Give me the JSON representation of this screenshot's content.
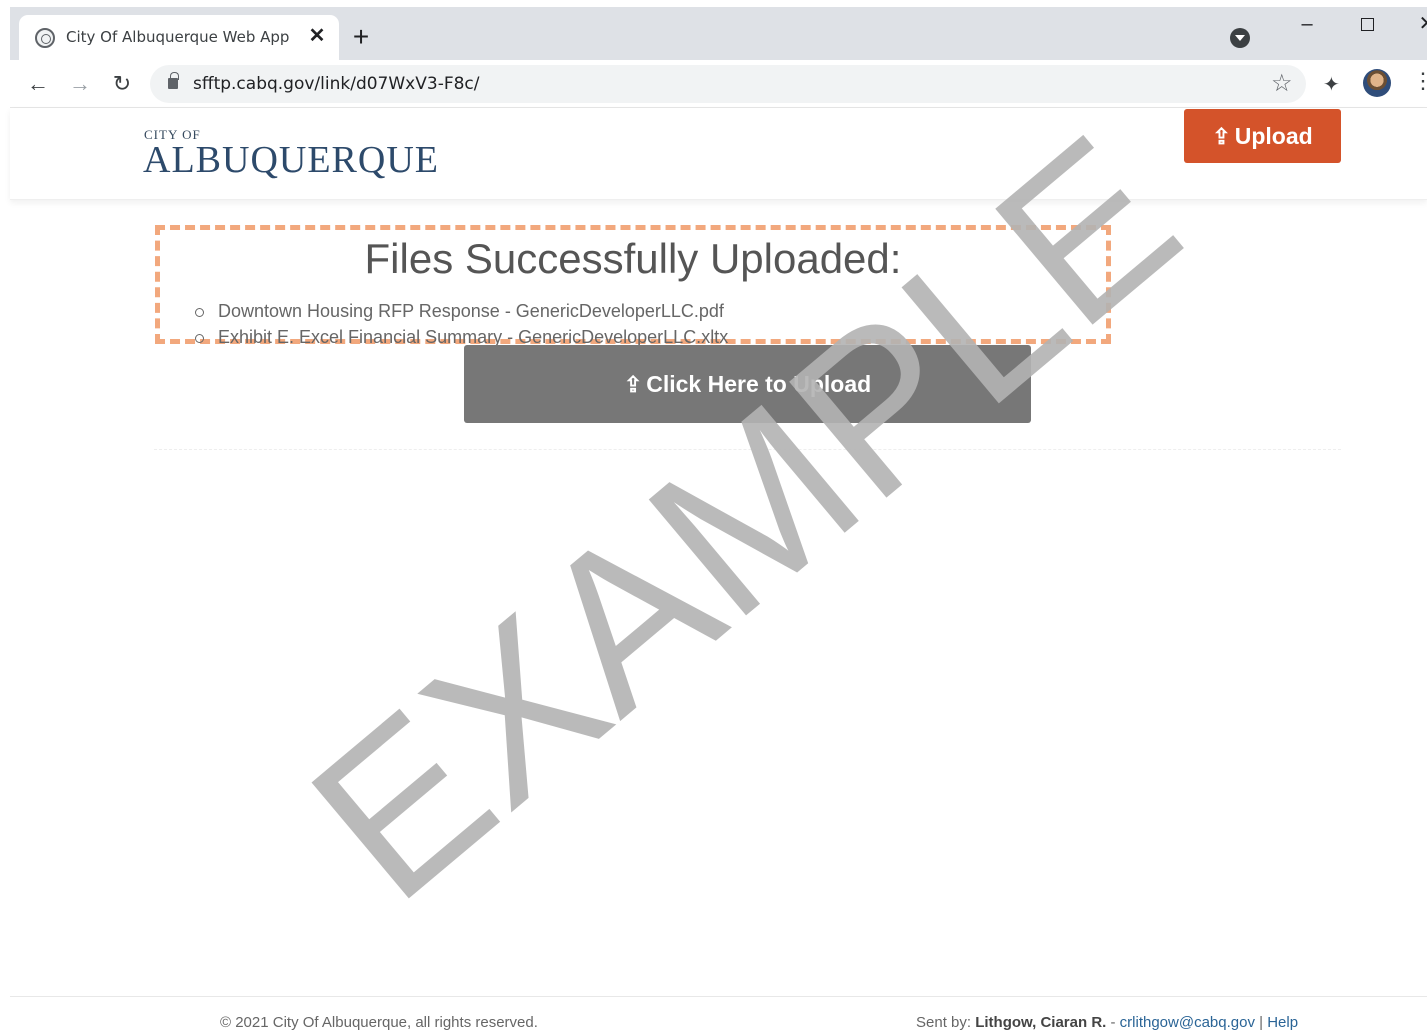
{
  "browser": {
    "tab_title": "City Of Albuquerque Web App - ",
    "tab_close": "✕",
    "new_tab": "+",
    "url": "sfftp.cabq.gov/link/d07WxV3-F8c/",
    "window_minimize": "–",
    "window_close": "✕",
    "nav_back": "←",
    "nav_forward": "→",
    "nav_reload": "↻",
    "star": "☆",
    "extensions": "✦",
    "menu": "⋮"
  },
  "header": {
    "logo_top": "CITY OF",
    "logo_main": "ALBUQUERQUE",
    "upload_label": "Upload",
    "upload_icon": "⇪"
  },
  "main": {
    "success_title": "Files Successfully Uploaded:",
    "files": [
      "Downtown Housing RFP Response - GenericDeveloperLLC.pdf",
      "Exhibit E. Excel Financial Summary - GenericDeveloperLLC.xltx"
    ],
    "big_upload_label": "Click Here to Upload",
    "big_upload_icon": "⇪"
  },
  "footer": {
    "copyright": "© 2021 City Of Albuquerque, all rights reserved.",
    "sent_by_label": "Sent by: ",
    "sent_by_name": "Lithgow, Ciaran R.",
    "separator": " - ",
    "email": "crlithgow@cabq.gov",
    "pipe": " | ",
    "help": "Help"
  },
  "watermark": {
    "text": "EXAMPLE",
    "color": "#b3b3b3"
  },
  "colors": {
    "accent": "#d4532a",
    "dashed_border": "#f2a87d",
    "button_gray": "#777777"
  }
}
